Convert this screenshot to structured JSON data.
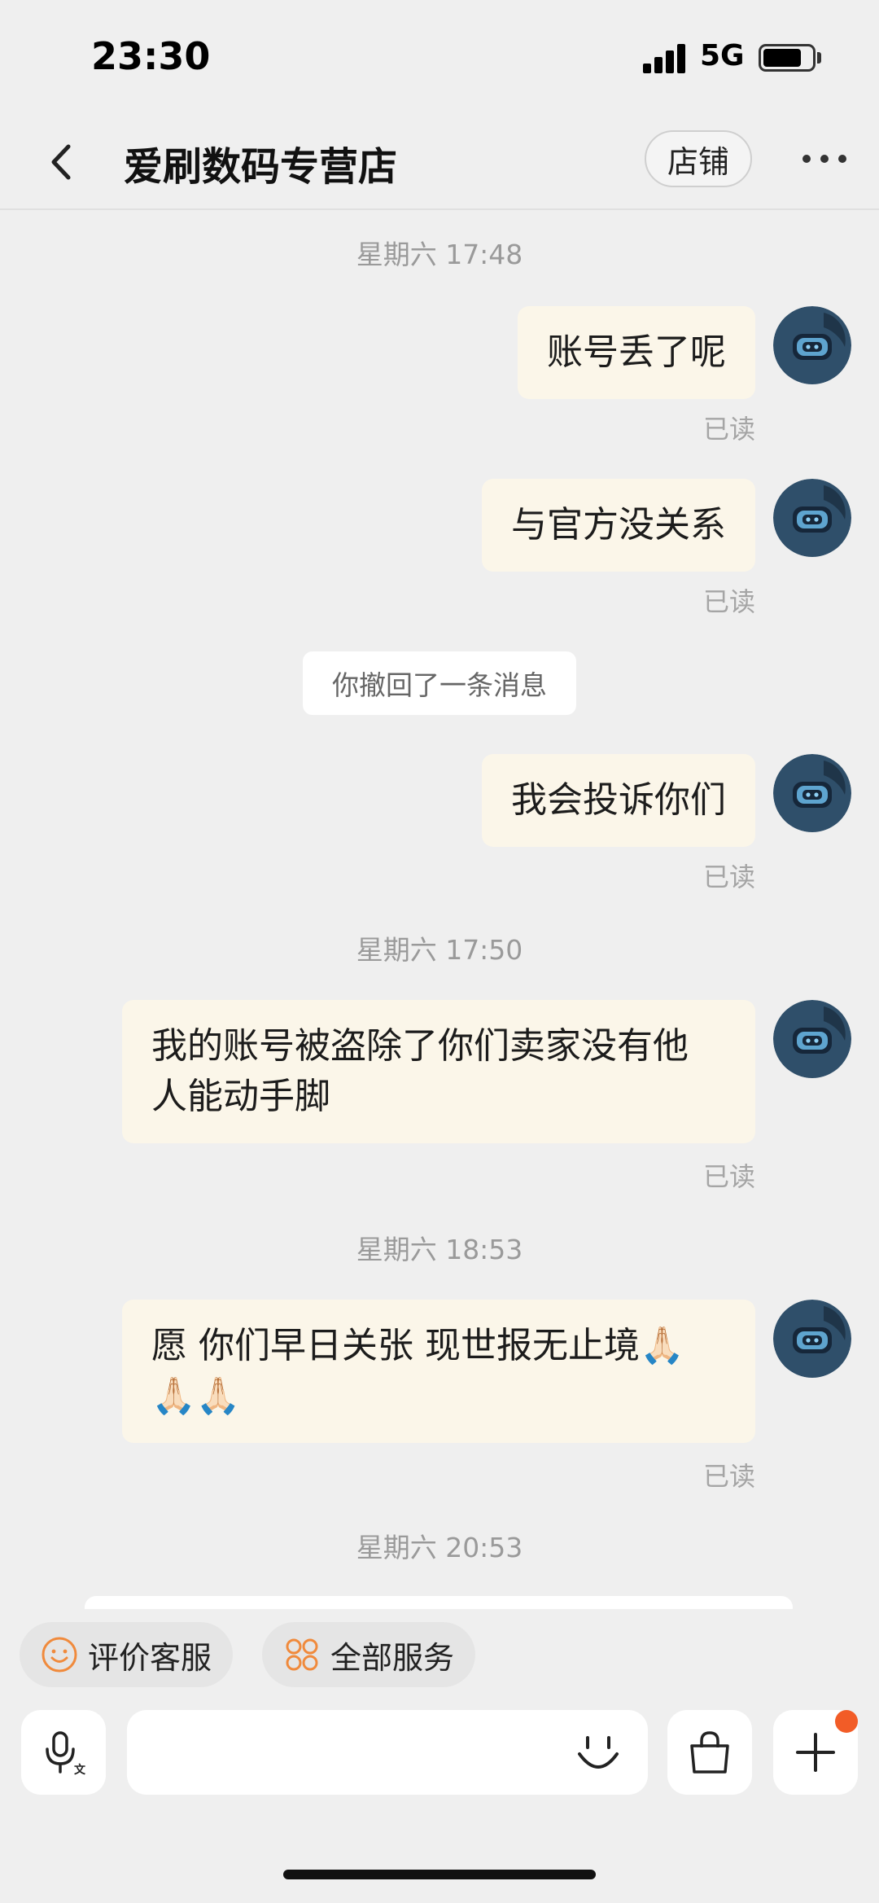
{
  "status_bar": {
    "time": "23:30",
    "network": "5G"
  },
  "nav": {
    "title": "爱刷数码专营店",
    "shop_button": "店铺",
    "back_icon": "chevron-left-icon",
    "more_icon": "more-dots-icon"
  },
  "messages": [
    {
      "type": "timestamp",
      "text": "星期六 17:48"
    },
    {
      "type": "sent",
      "text": "账号丢了呢",
      "status": "已读"
    },
    {
      "type": "sent",
      "text": "与官方没关系",
      "status": "已读"
    },
    {
      "type": "recall",
      "text": "你撤回了一条消息"
    },
    {
      "type": "sent",
      "text": "我会投诉你们",
      "status": "已读"
    },
    {
      "type": "timestamp",
      "text": "星期六 17:50"
    },
    {
      "type": "sent",
      "lines": [
        "我的账号被盗除了你们卖家没有他",
        "人能动手脚"
      ],
      "status": "已读"
    },
    {
      "type": "timestamp",
      "text": "星期六 18:53"
    },
    {
      "type": "sent",
      "lines": [
        "愿 你们早日关张 现世报无止境🙏🏻",
        "🙏🏻🙏🏻"
      ],
      "status": "已读"
    },
    {
      "type": "timestamp",
      "text": "星期六 20:53"
    }
  ],
  "shortcuts": [
    {
      "label": "评价客服",
      "icon": "smile-icon"
    },
    {
      "label": "全部服务",
      "icon": "grid-services-icon"
    }
  ],
  "input_bar": {
    "voice_icon": "voice-translate-icon",
    "placeholder": "",
    "emoji_icon": "emoji-icon",
    "bag_icon": "shopping-bag-icon",
    "plus_icon": "plus-icon"
  },
  "colors": {
    "accent": "#f25c27",
    "bubble_bg": "#fbf6e9",
    "page_bg": "#efefef"
  }
}
